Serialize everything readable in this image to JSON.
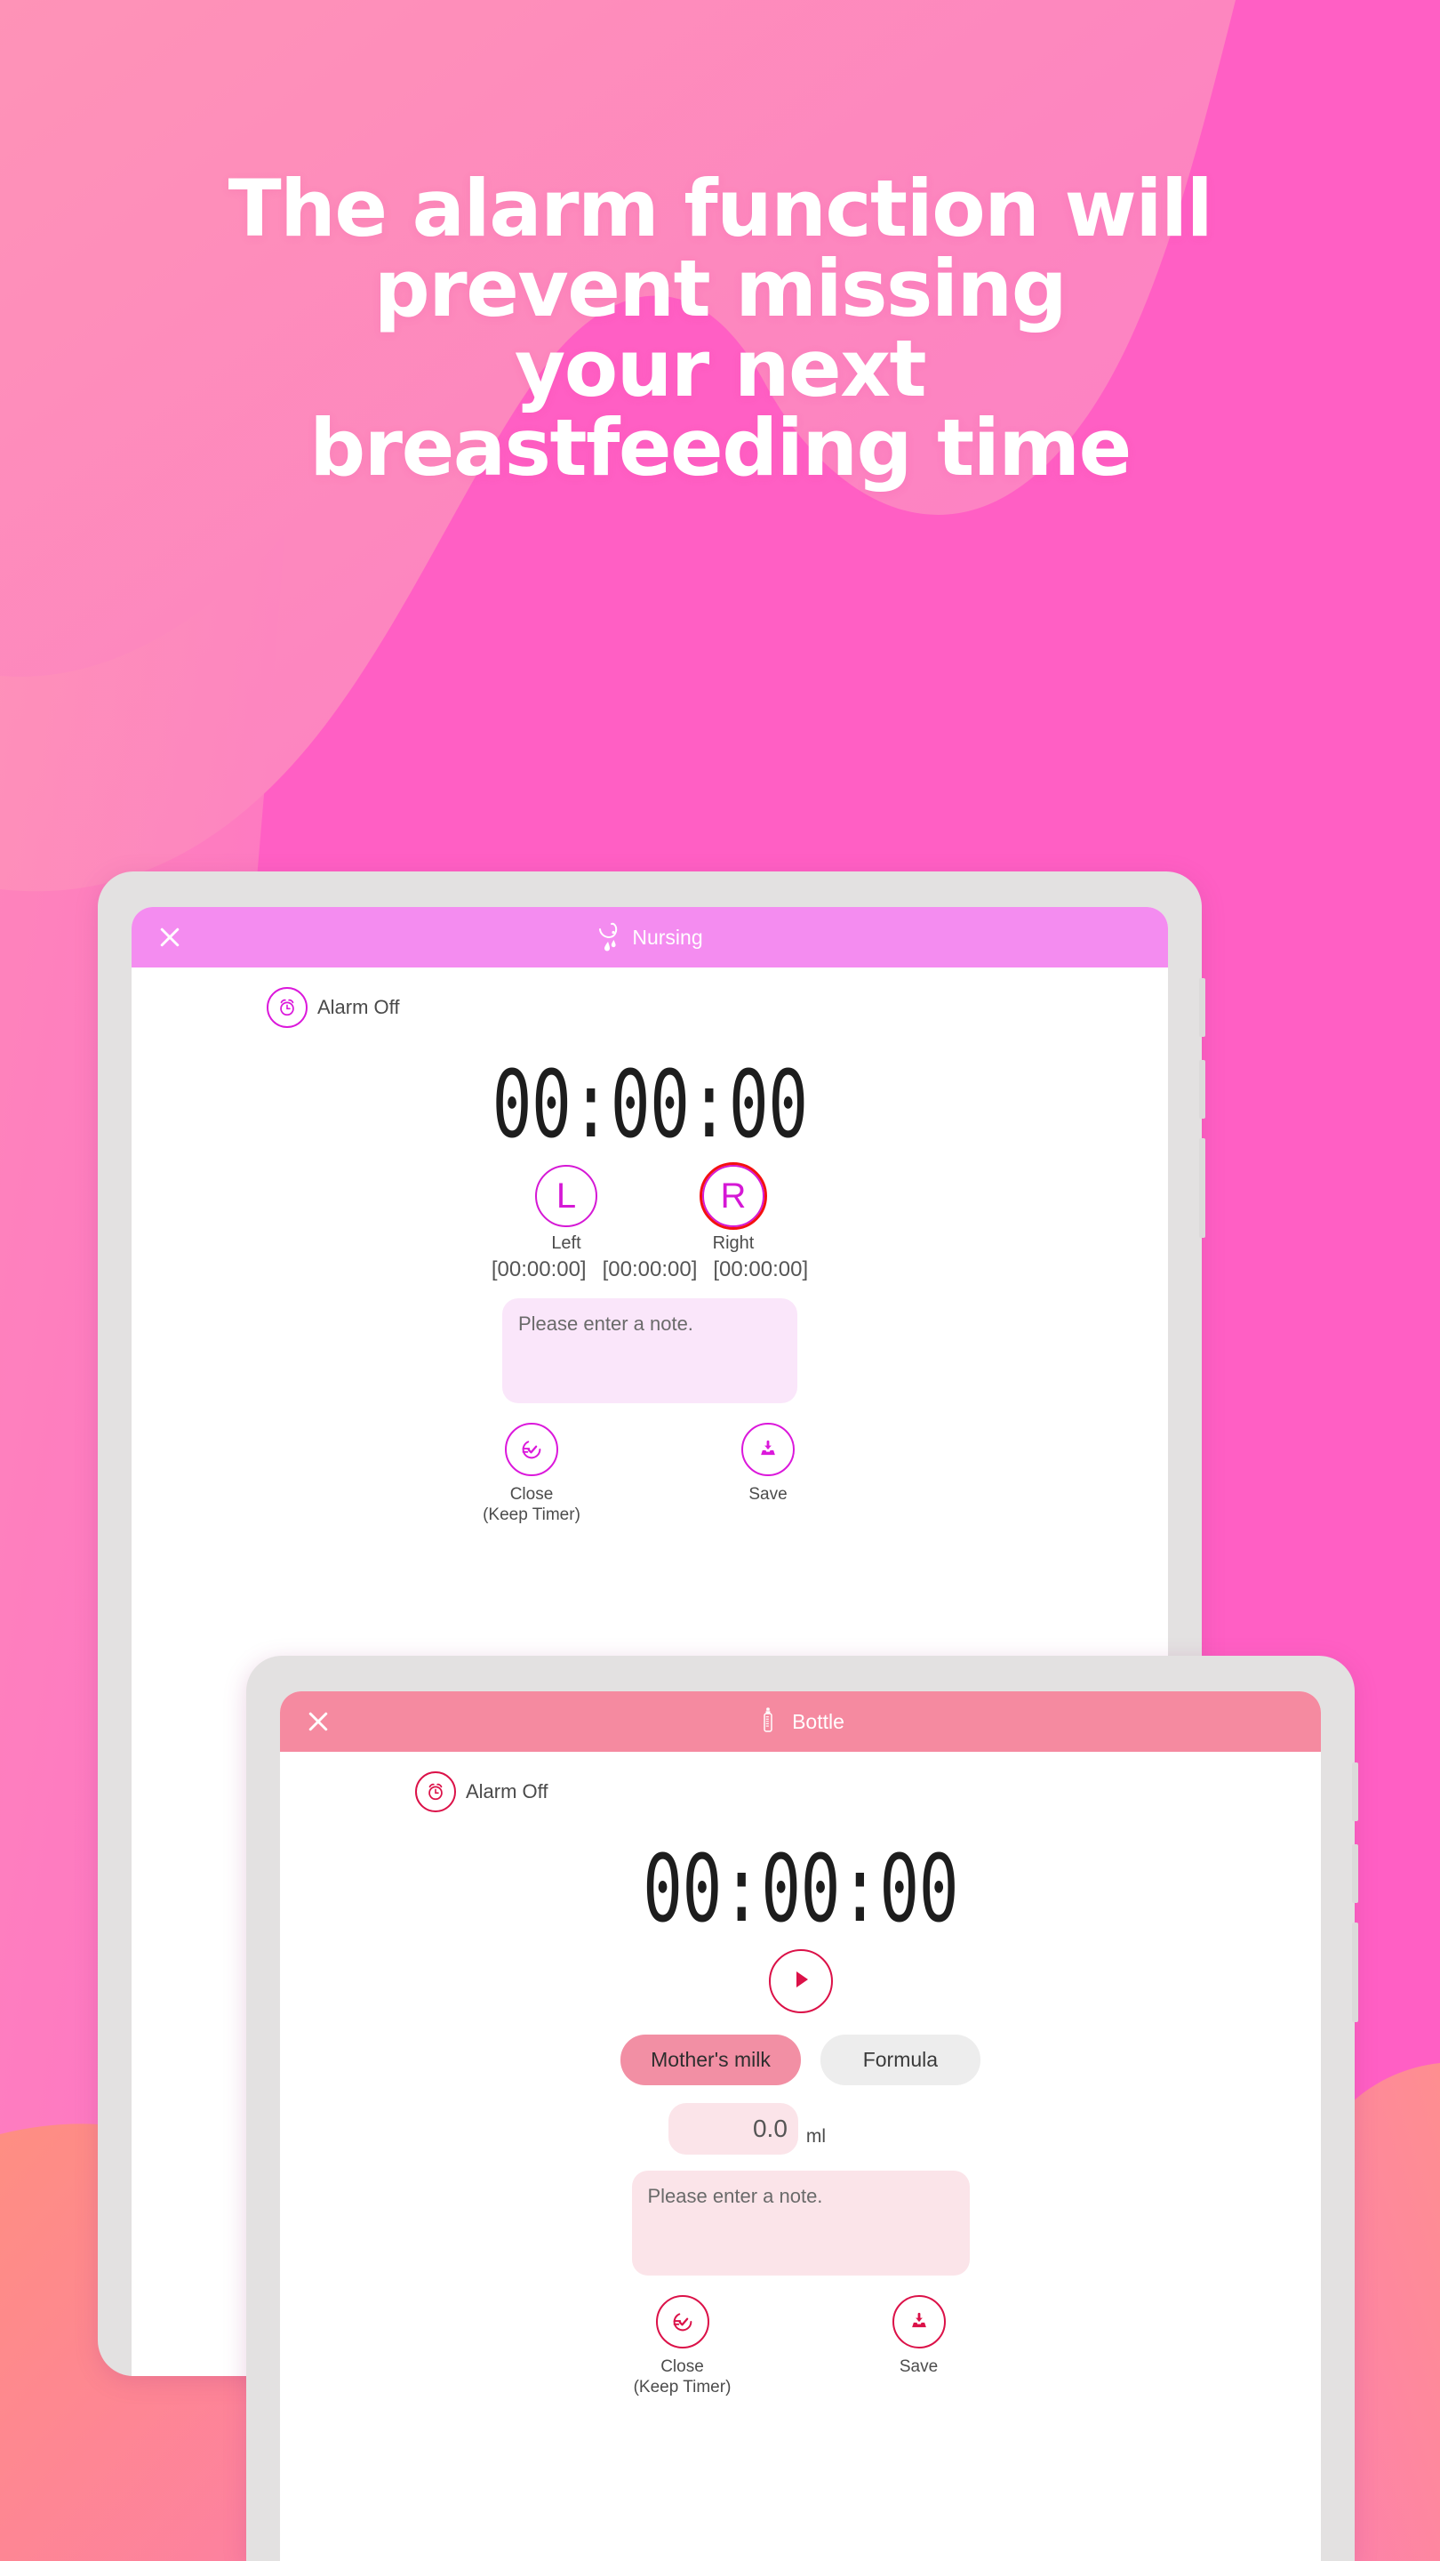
{
  "headline": {
    "lines": [
      "The alarm function will",
      "prevent missing",
      "your next",
      "breastfeeding time"
    ],
    "color": "#FFFFFF"
  },
  "background": {
    "base_color": "#FF5FC4",
    "light_blob_color": "#FD8FBE",
    "coral_blob_color": "#FD8190"
  },
  "nursing_screen": {
    "accent_color": "#DB18DB",
    "header_color": "#F48CF0",
    "close_label": "✕",
    "title": "Nursing",
    "title_icon": "breast-milk-icon",
    "alarm": {
      "icon": "alarm-clock-icon",
      "label": "Alarm Off"
    },
    "timer": "00:00:00",
    "sides": [
      {
        "letter": "L",
        "caption": "Left",
        "selected": false
      },
      {
        "letter": "R",
        "caption": "Right",
        "selected": true
      }
    ],
    "side_times": [
      "[00:00:00]",
      "[00:00:00]",
      "[00:00:00]"
    ],
    "note_placeholder": "Please enter a note.",
    "actions": [
      {
        "icon": "clock-check-icon",
        "label_line1": "Close",
        "label_line2": "(Keep Timer)"
      },
      {
        "icon": "save-tray-icon",
        "label_line1": "Save",
        "label_line2": ""
      }
    ]
  },
  "bottle_screen": {
    "accent_color": "#DB1148",
    "header_color": "#F58AA0",
    "close_label": "✕",
    "title": "Bottle",
    "title_icon": "baby-bottle-icon",
    "alarm": {
      "icon": "alarm-clock-icon",
      "label": "Alarm Off"
    },
    "timer": "00:00:00",
    "play_icon": "play-icon",
    "milk_types": [
      {
        "label": "Mother's milk",
        "selected": true
      },
      {
        "label": "Formula",
        "selected": false
      }
    ],
    "amount_value": "0.0",
    "amount_unit": "ml",
    "note_placeholder": "Please enter a note.",
    "actions": [
      {
        "icon": "clock-check-icon",
        "label_line1": "Close",
        "label_line2": "(Keep Timer)"
      },
      {
        "icon": "save-tray-icon",
        "label_line1": "Save",
        "label_line2": ""
      }
    ]
  }
}
